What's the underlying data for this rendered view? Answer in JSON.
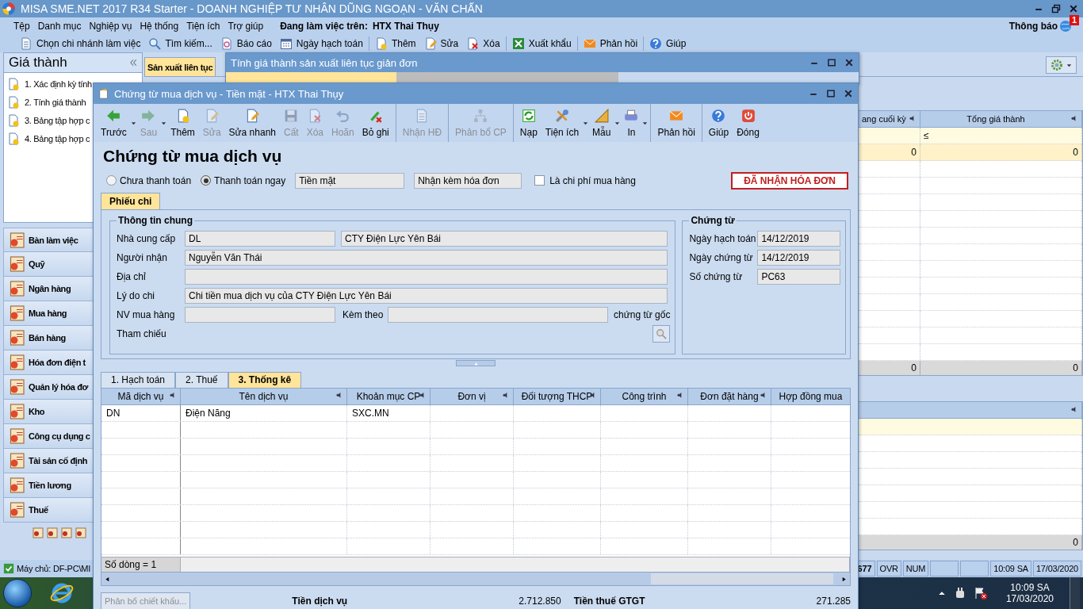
{
  "window": {
    "title": "MISA SME.NET 2017 R34 Starter - DOANH NGHIỆP TƯ NHÂN DŨNG NGOẠN - VĂN CHẤN"
  },
  "menu": [
    "Tệp",
    "Danh mục",
    "Nghiệp vụ",
    "Hệ thống",
    "Tiện ích",
    "Trợ giúp"
  ],
  "workspace": {
    "label": "Đang làm việc trên:",
    "value": "HTX Thai Thụy"
  },
  "notifications": {
    "label": "Thông báo",
    "count": "1"
  },
  "toolbar": [
    {
      "label": "Chọn chi nhánh làm việc",
      "kind": "doc",
      "separated": false
    },
    {
      "label": "Tìm kiếm...",
      "kind": "search",
      "separated": false
    },
    {
      "label": "Báo cáo",
      "kind": "report",
      "separated": false
    },
    {
      "label": "Ngày hạch toán",
      "kind": "calendar",
      "separated": false
    },
    {
      "label": "Thêm",
      "kind": "add",
      "separated": true
    },
    {
      "label": "Sửa",
      "kind": "edit",
      "separated": false
    },
    {
      "label": "Xóa",
      "kind": "delete",
      "separated": false
    },
    {
      "label": "Xuất khẩu",
      "kind": "excel",
      "separated": true
    },
    {
      "label": "Phản hồi",
      "kind": "mail",
      "separated": true
    },
    {
      "label": "Giúp",
      "kind": "help",
      "separated": true
    }
  ],
  "sidebar": {
    "title": "Giá thành",
    "items": [
      "1. Xác định kỳ tính",
      "2. Tính giá thành",
      "3. Bảng tập hợp c",
      "4. Bảng tập hợp c"
    ],
    "modules": [
      "Bàn làm việc",
      "Quỹ",
      "Ngân hàng",
      "Mua hàng",
      "Bán hàng",
      "Hóa đơn điện t",
      "Quản lý hóa đơ",
      "Kho",
      "Công cụ dụng c",
      "Tài sản cố định",
      "Tiền lương",
      "Thuế"
    ]
  },
  "page_tabs": [
    {
      "label": "Sản xuất liên tục",
      "selected": true
    }
  ],
  "cost_grid": {
    "columns": [
      {
        "label": "ang cuối kỳ"
      },
      {
        "label": "Tổng giá thành"
      }
    ],
    "filter": "≤",
    "row": [
      "0",
      "0"
    ],
    "totals": [
      "0",
      "0"
    ]
  },
  "second_grid": {
    "totals": [
      "0"
    ]
  },
  "back_window": {
    "title": "Tính giá thành sản xuất liên tục giản đơn"
  },
  "voucher": {
    "title": "Chứng từ mua dịch vụ - Tiền mặt - HTX Thai Thụy",
    "toolbar": [
      {
        "label": "Trước",
        "kind": "back",
        "disabled": false,
        "dropdown": true,
        "separated": false
      },
      {
        "label": "Sau",
        "kind": "forward",
        "disabled": true,
        "dropdown": true,
        "separated": false
      },
      {
        "label": "Thêm",
        "kind": "add",
        "disabled": false,
        "dropdown": false,
        "separated": false
      },
      {
        "label": "Sửa",
        "kind": "edit",
        "disabled": true,
        "dropdown": false,
        "separated": false
      },
      {
        "label": "Sửa nhanh",
        "kind": "edit",
        "disabled": false,
        "dropdown": false,
        "separated": false
      },
      {
        "label": "Cất",
        "kind": "save",
        "disabled": true,
        "dropdown": false,
        "separated": false
      },
      {
        "label": "Xóa",
        "kind": "delete",
        "disabled": true,
        "dropdown": false,
        "separated": false
      },
      {
        "label": "Hoãn",
        "kind": "undo",
        "disabled": true,
        "dropdown": false,
        "separated": false
      },
      {
        "label": "Bỏ ghi",
        "kind": "unpost",
        "disabled": false,
        "dropdown": false,
        "separated": false
      },
      {
        "label": "Nhận HĐ",
        "kind": "receive",
        "disabled": true,
        "dropdown": false,
        "separated": true
      },
      {
        "label": "Phân bổ CP",
        "kind": "allocate",
        "disabled": true,
        "dropdown": false,
        "separated": true
      },
      {
        "label": "Nạp",
        "kind": "reload",
        "disabled": false,
        "dropdown": false,
        "separated": true
      },
      {
        "label": "Tiện ích",
        "kind": "tools",
        "disabled": false,
        "dropdown": true,
        "separated": false
      },
      {
        "label": "Mẫu",
        "kind": "template",
        "disabled": false,
        "dropdown": true,
        "separated": false
      },
      {
        "label": "In",
        "kind": "print",
        "disabled": false,
        "dropdown": true,
        "separated": false
      },
      {
        "label": "Phản hồi",
        "kind": "mail",
        "disabled": false,
        "dropdown": false,
        "separated": true
      },
      {
        "label": "Giúp",
        "kind": "help",
        "disabled": false,
        "dropdown": false,
        "separated": true
      },
      {
        "label": "Đóng",
        "kind": "close",
        "disabled": false,
        "dropdown": false,
        "separated": false
      }
    ],
    "heading": "Chứng từ mua dịch vụ",
    "payment": [
      {
        "label": "Chưa thanh toán",
        "selected": false
      },
      {
        "label": "Thanh toán ngay",
        "selected": true
      }
    ],
    "method": "Tiền mặt",
    "invoice": "Nhận kèm hóa đơn",
    "purchase_cost": {
      "label": "Là chi phí mua hàng",
      "checked": false
    },
    "invoice_status": "ĐÃ NHẬN HÓA ĐƠN",
    "form_tabs": [
      {
        "label": "Phiếu chi",
        "selected": true
      }
    ],
    "general": {
      "title": "Thông tin chung",
      "supplier": {
        "label": "Nhà cung cấp",
        "code": "DL",
        "name": "CTY Điện Lực Yên Bái"
      },
      "receiver": {
        "label": "Người nhận",
        "value": "Nguyễn Văn Thái"
      },
      "address": {
        "label": "Địa chỉ"
      },
      "reason": {
        "label": "Lý do chi",
        "value": "Chi tiền mua dịch vụ của CTY Điện Lực Yên Bái"
      },
      "buyer": {
        "label": "NV mua hàng"
      },
      "attached": {
        "label": "Kèm theo",
        "suffix": "chứng từ gốc"
      },
      "reference": {
        "label": "Tham chiếu"
      }
    },
    "document": {
      "title": "Chứng từ",
      "fields": [
        {
          "label": "Ngày hạch toán",
          "value": "14/12/2019"
        },
        {
          "label": "Ngày chứng từ",
          "value": "14/12/2019"
        },
        {
          "label": "Số chứng từ",
          "value": "PC63"
        }
      ]
    },
    "detail_tabs": [
      {
        "label": "1. Hạch toán",
        "selected": false
      },
      {
        "label": "2. Thuế",
        "selected": false
      },
      {
        "label": "3. Thống kê",
        "selected": true
      }
    ],
    "grid": {
      "columns": [
        {
          "label": "Mã dịch vụ",
          "pinned": true
        },
        {
          "label": "Tên dịch vụ",
          "pinned": true
        },
        {
          "label": "Khoản mục CP",
          "pinned": true
        },
        {
          "label": "Đơn vị",
          "pinned": true
        },
        {
          "label": "Đối tượng THCP",
          "pinned": true
        },
        {
          "label": "Công trình",
          "pinned": true
        },
        {
          "label": "Đơn đặt hàng",
          "pinned": true
        },
        {
          "label": "Hợp đồng mua",
          "pinned": false
        }
      ],
      "rows": [
        [
          "DN",
          "Điện Năng",
          "SXC.MN"
        ]
      ],
      "footer": "Số dòng = 1"
    },
    "allocate_button": {
      "label": "Phân bổ chiết khấu...",
      "disabled": true
    },
    "totals": [
      {
        "label": "Tiền dịch vụ",
        "value": "2.712.850"
      },
      {
        "label": "Tiền thuế GTGT",
        "value": "271.285"
      }
    ]
  },
  "status_bar": {
    "server": "Máy chủ: DF-PC\\MI",
    "cells": [
      "677",
      "OVR",
      "NUM"
    ],
    "time": "10:09 SA",
    "date": "17/03/2020"
  },
  "taskbar": {
    "time": "10:09 SA",
    "date": "17/03/2020"
  }
}
